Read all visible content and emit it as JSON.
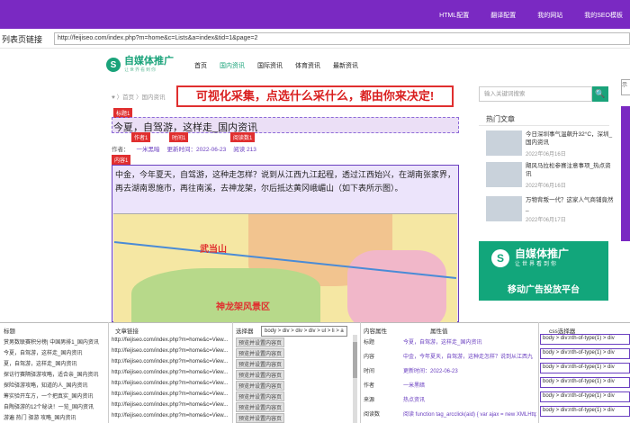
{
  "topnav": [
    "HTML配置",
    "翻译配置",
    "我的网站",
    "我的SEO模板"
  ],
  "urlbar": {
    "label": "列表页链接",
    "value": "http://feijiseo.com/index.php?m=home&c=Lists&a=index&tid=1&page=2"
  },
  "site": {
    "logo_mark": "S",
    "logo_name": "自媒体推广",
    "logo_sub": "让世界看到你",
    "nav": [
      "首页",
      "国内资讯",
      "国际资讯",
      "体育资讯",
      "最新资讯"
    ],
    "breadcrumb": "♥ 〉首页 〉国内资讯"
  },
  "banner": "可视化采集，点选什么采什么，都由你来决定!",
  "tags": {
    "title": "标题1",
    "author": "作者1",
    "time": "时间1",
    "reads": "阅读数1",
    "content": "内容1"
  },
  "article": {
    "title": "今夏，自驾游，这样走_国内资讯",
    "author_label": "作者：",
    "author": "一米黑暗",
    "time": "更新时间：2022-06-23",
    "reads": "阅读 213",
    "body": "中金，今年夏天，自驾游，这种走怎样？说到从江西九江起程，透过江西始兴，在湖南张家界，再去湖南恩施市，再往南溪，去神龙架，尔后抵达黄冈峨嵋山（如下表所示图）。"
  },
  "map": {
    "label1": "武当山",
    "label2": "神龙架风景区"
  },
  "sidebar": {
    "search_placeholder": "输入关键词搜索",
    "search_icon": "🔍",
    "hot_title": "热门文章",
    "items": [
      {
        "title": "今日深圳事气温飙升32°C，深圳_国内资讯",
        "date": "2022年06月16日"
      },
      {
        "title": "飓风马拉松参赛注意事项_热点资讯",
        "date": "2022年06月16日"
      },
      {
        "title": "万物背叛一代？这家人气商铺竟然_",
        "date": "2022年06月17日"
      }
    ],
    "ad": {
      "mark": "S",
      "name": "自媒体推广",
      "sub": "让世界看到你",
      "slogan": "移动广告投放平台"
    },
    "side_label": "示"
  },
  "panel": {
    "headers": {
      "title": "标题",
      "link": "文章链接",
      "selector": "选择器",
      "prop": "内容属性",
      "value": "属性值",
      "css": "css选择器"
    },
    "tooltip": "body > div > div > div > ul > li > a",
    "rows": [
      {
        "title": "赏男数联赛积分榜| 中国男排1_国内资讯",
        "link": "http://feijiseo.com/index.php?m=home&c=View...",
        "btn": "预览并设置内容页"
      },
      {
        "title": "今夏，自驾游，这样走_国内资讯",
        "link": "http://feijiseo.com/index.php?m=home&c=View...",
        "btn": "预览并设置内容页"
      },
      {
        "title": "夏，自驾游，这样走_国内资讯",
        "link": "http://feijiseo.com/index.php?m=home&c=View...",
        "btn": "预览并设置内容页"
      },
      {
        "title": "探访行赛隔驿游攻略，适合亲_国内资讯",
        "link": "http://feijiseo.com/index.php?m=home&c=View...",
        "btn": "预览并设置内容页"
      },
      {
        "title": "探险驿游攻略，知道的人_国内资讯",
        "link": "http://feijiseo.com/index.php?m=home&c=View...",
        "btn": "预览并设置内容页"
      },
      {
        "title": "筹实验开车方，一个把真实_国内资讯",
        "link": "http://feijiseo.com/index.php?m=home&c=View...",
        "btn": "预览并设置内容页"
      },
      {
        "title": "自陶驿游的12个秘诀！一览_国内资讯",
        "link": "http://feijiseo.com/index.php?m=home&c=View...",
        "btn": "预览并设置内容页"
      },
      {
        "title": "游遍 热门 驿游 攻略_国内资讯",
        "link": "http://feijiseo.com/index.php?m=home&c=View...",
        "btn": "预览并设置内容页"
      }
    ],
    "props": [
      {
        "prop": "标题",
        "value": "今夏，自驾游，这样走_国内资讯",
        "css": "body > div:nth-of-type(1) > div"
      },
      {
        "prop": "内容",
        "value": "中金，今年夏天，自驾游，这种走怎样？说到从江西九",
        "css": "body > div:nth-of-type(1) > div"
      },
      {
        "prop": "时间",
        "value": "更新时间：2022-06-23",
        "css": "body > div:nth-of-type(1) > div"
      },
      {
        "prop": "作者",
        "value": "一米黑暗",
        "css": "body > div:nth-of-type(1) > div"
      },
      {
        "prop": "来源",
        "value": "热点资讯",
        "css": "body > div:nth-of-type(1) > div"
      },
      {
        "prop": "阅读数",
        "value": "阅读 function tag_arcclick(aid) { var ajax = new XMLHttpR...",
        "css": "body > div:nth-of-type(1) > div"
      }
    ]
  }
}
